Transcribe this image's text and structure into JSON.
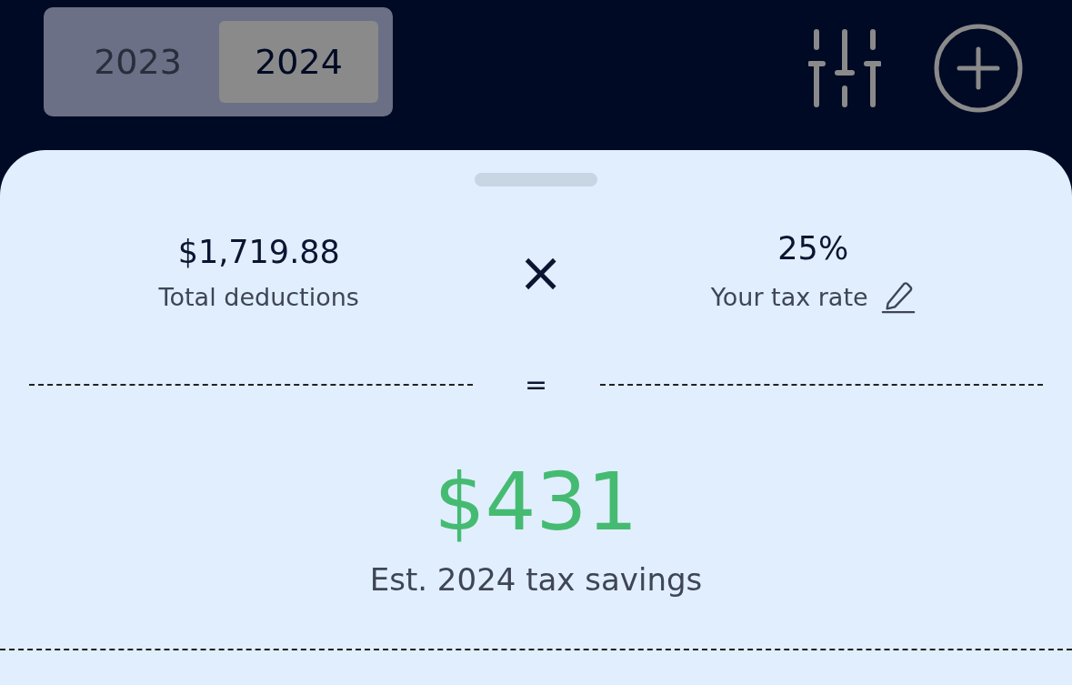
{
  "year_tabs": [
    {
      "label": "2023",
      "selected": false
    },
    {
      "label": "2024",
      "selected": true
    }
  ],
  "summary": {
    "deductions_value": "$1,719.88",
    "deductions_label": "Total deductions",
    "operator": "×",
    "rate_value": "25%",
    "rate_label": "Your tax rate",
    "equals": "=",
    "savings_value": "$431",
    "savings_label": "Est. 2024 tax savings"
  }
}
